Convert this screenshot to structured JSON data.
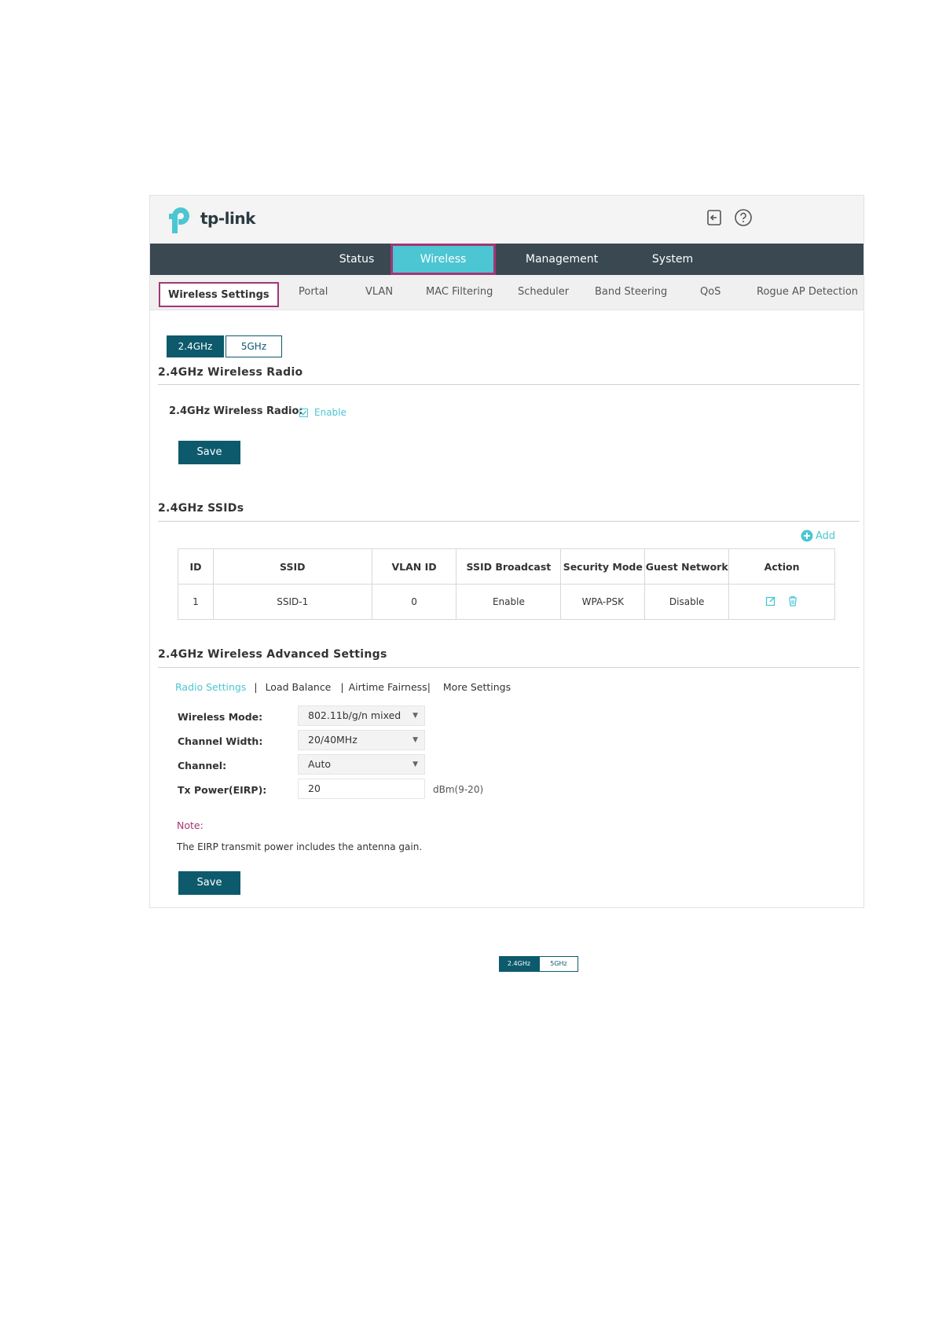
{
  "logo": {
    "text": "tp-link"
  },
  "header_icons": [
    "logout-icon",
    "help-icon"
  ],
  "main_nav": {
    "tabs": [
      {
        "label": "Status"
      },
      {
        "label": "Wireless",
        "active": true
      },
      {
        "label": "Management"
      },
      {
        "label": "System"
      }
    ]
  },
  "sub_nav": {
    "items": [
      {
        "label": "Wireless Settings",
        "active": true
      },
      {
        "label": "Portal"
      },
      {
        "label": "VLAN"
      },
      {
        "label": "MAC Filtering"
      },
      {
        "label": "Scheduler"
      },
      {
        "label": "Band Steering"
      },
      {
        "label": "QoS"
      },
      {
        "label": "Rogue AP Detection"
      }
    ]
  },
  "band_tabs": {
    "active": "2.4GHz",
    "inactive": "5GHz"
  },
  "radio_section": {
    "title": "2.4GHz Wireless Radio",
    "field_label": "2.4GHz Wireless Radio:",
    "checkbox_checked": true,
    "checkbox_label": "Enable",
    "save_label": "Save"
  },
  "ssid_section": {
    "title": "2.4GHz SSIDs",
    "add_label": "Add",
    "columns": [
      "ID",
      "SSID",
      "VLAN ID",
      "SSID Broadcast",
      "Security Mode",
      "Guest Network",
      "Action"
    ],
    "rows": [
      {
        "id": "1",
        "ssid": "SSID-1",
        "vlan_id": "0",
        "broadcast": "Enable",
        "security": "WPA-PSK",
        "guest": "Disable"
      }
    ]
  },
  "advanced_section": {
    "title": "2.4GHz Wireless Advanced Settings",
    "tabs": {
      "radio_settings": "Radio Settings",
      "sep1": "|",
      "load_balance": "Load Balance",
      "sep2": "|",
      "airtime_fairness": "Airtime Fairness|",
      "more_settings": "More Settings"
    },
    "wireless_mode": {
      "label": "Wireless Mode:",
      "value": "802.11b/g/n mixed"
    },
    "channel_width": {
      "label": "Channel Width:",
      "value": "20/40MHz"
    },
    "channel": {
      "label": "Channel:",
      "value": "Auto"
    },
    "tx_power": {
      "label": "Tx Power(EIRP):",
      "value": "20",
      "unit": "dBm(9-20)"
    },
    "note_title": "Note:",
    "note_text": "The EIRP transmit power includes the antenna gain.",
    "save_label": "Save"
  },
  "mini_band_tabs": {
    "active": "2.4GHz",
    "inactive": "5GHz"
  },
  "colors": {
    "nav_bg": "#3a4851",
    "accent": "#4cc6d3",
    "primary_button": "#0d5a6d",
    "highlight_border": "#a33576"
  }
}
